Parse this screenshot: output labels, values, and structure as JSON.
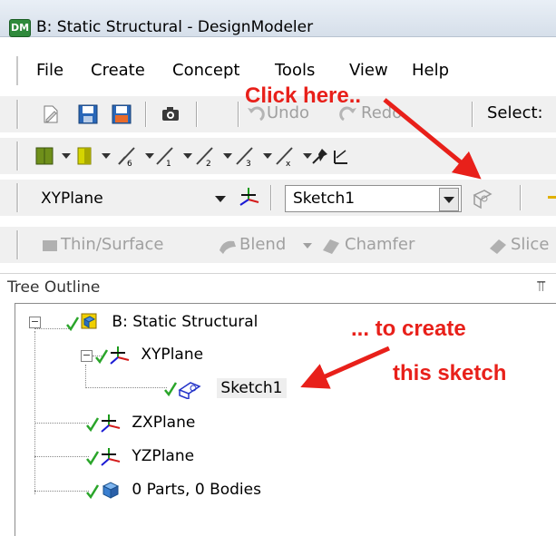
{
  "window": {
    "title": "B: Static Structural - DesignModeler",
    "logo_text": "DM"
  },
  "menu": [
    "File",
    "Create",
    "Concept",
    "Tools",
    "View",
    "Help"
  ],
  "toolbar1": {
    "undo_label": "Undo",
    "redo_label": "Redo",
    "select_label": "Select:"
  },
  "toolbar2": {
    "icons": [
      "graph-icon",
      "graph-icon",
      "line-6-icon",
      "line-1-icon",
      "line-2-icon",
      "line-3-icon",
      "line-x-icon",
      "pin-icon",
      "angle-icon"
    ]
  },
  "toolbar3": {
    "plane_value": "XYPlane",
    "sketch_value": "Sketch1"
  },
  "toolbar4": {
    "thin_surface": "Thin/Surface",
    "blend": "Blend",
    "chamfer": "Chamfer",
    "slice": "Slice"
  },
  "tree": {
    "header": "Tree Outline",
    "root": "B: Static Structural",
    "items": [
      "XYPlane",
      "Sketch1",
      "ZXPlane",
      "YZPlane",
      "0 Parts, 0 Bodies"
    ]
  },
  "annotations": {
    "click_here": "Click here..",
    "to_create": "... to create",
    "this_sketch": "this sketch"
  },
  "colors": {
    "annotation": "#e8201a",
    "check": "#2aa52a"
  }
}
